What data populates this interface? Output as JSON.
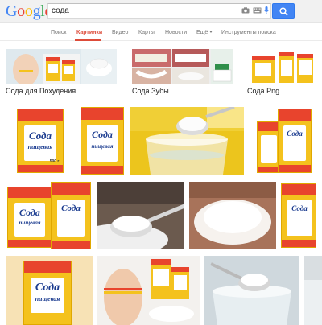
{
  "logo": {
    "g1": "G",
    "o1": "o",
    "o2": "o",
    "g2": "g",
    "l": "l",
    "e": "e"
  },
  "search": {
    "query": "сода"
  },
  "nav": {
    "items": [
      {
        "label": "Поиск"
      },
      {
        "label": "Картинки"
      },
      {
        "label": "Видео"
      },
      {
        "label": "Карты"
      },
      {
        "label": "Новости"
      },
      {
        "label": "Ещё"
      },
      {
        "label": "Инструменты поиска"
      }
    ]
  },
  "related": [
    {
      "label": "Сода для Похудения"
    },
    {
      "label": "Сода Зубы"
    },
    {
      "label": "Сода Png"
    }
  ],
  "package": {
    "word": "Сода",
    "word2": "пищевая",
    "weight": "500 г"
  },
  "colors": {
    "accent_red": "#dd4b39",
    "search_blue": "#4285f4",
    "box_yellow": "#f4c21d",
    "box_red": "#e8442d",
    "box_text_blue": "#1a3b8f"
  }
}
